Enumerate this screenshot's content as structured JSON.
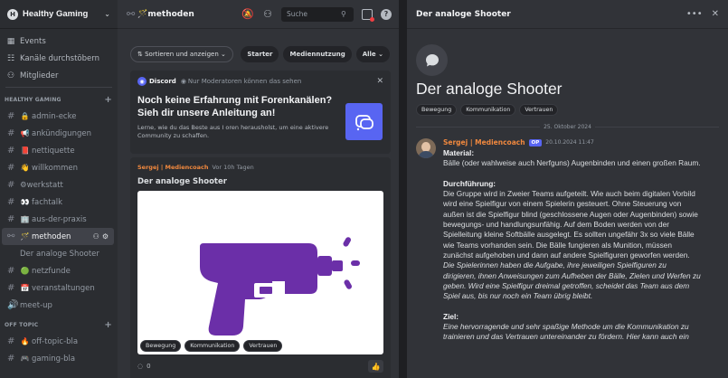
{
  "server": {
    "name": "Healthy Gaming",
    "icon_letter": "H"
  },
  "nav": [
    {
      "label": "Events",
      "icon": "calendar-icon"
    },
    {
      "label": "Kanäle durchstöbern",
      "icon": "browse-icon"
    },
    {
      "label": "Mitglieder",
      "icon": "members-icon"
    }
  ],
  "categories": {
    "healthy": "HEALTHY GAMING",
    "offtopic": "OFF TOPIC"
  },
  "channels": [
    {
      "prefix": "#",
      "emoji": "🔒",
      "name": "admin-ecke"
    },
    {
      "prefix": "#",
      "emoji": "📢",
      "name": "ankündigungen"
    },
    {
      "prefix": "#",
      "emoji": "📕",
      "name": "nettiquette"
    },
    {
      "prefix": "#",
      "emoji": "👋",
      "name": "willkommen"
    },
    {
      "prefix": "#",
      "emoji": "",
      "name": "⚙werkstatt"
    },
    {
      "prefix": "#",
      "emoji": "👀",
      "name": "fachtalk"
    },
    {
      "prefix": "#",
      "emoji": "🏢",
      "name": "aus-der-praxis"
    }
  ],
  "active_channel": {
    "name": "methoden",
    "emoji": "🪄"
  },
  "sub_thread": "Der analoge Shooter",
  "channels_after": [
    {
      "prefix": "#",
      "emoji": "🟢",
      "name": "netzfunde"
    },
    {
      "prefix": "#",
      "emoji": "📅",
      "name": "veranstaltungen"
    },
    {
      "prefix": "🔊",
      "emoji": "",
      "name": "meet-up"
    }
  ],
  "offtopic_channels": [
    {
      "prefix": "#",
      "emoji": "🔥",
      "name": "off-topic-bla"
    },
    {
      "prefix": "#",
      "emoji": "🎮",
      "name": "gaming-bla"
    }
  ],
  "forum": {
    "title": "🪄methoden",
    "search_placeholder": "Suche",
    "sort_label": "⇅ Sortieren und anzeigen ⌄",
    "filter_tags": [
      "Starter",
      "Mediennutzung",
      "Alle ⌄"
    ]
  },
  "notice": {
    "brand": "Discord",
    "visibility": "Nur Moderatoren können das sehen",
    "title": "Noch keine Erfahrung mit Forenkanälen? Sieh dir unsere Anleitung an!",
    "text": "Lerne, wie du das Beste aus I oren herausholst, um eine aktivere Community zu schaffen."
  },
  "post": {
    "author": "Sergej | Mediencoach",
    "time": "Vor 10h Tagen",
    "title": "Der analoge Shooter",
    "tags": [
      "Bewegung",
      "Kommunikation",
      "Vertrauen"
    ],
    "reactions": "0",
    "image_color": "#6b2fa8"
  },
  "thread": {
    "header_title": "Der analoge Shooter",
    "title": "Der analoge Shooter",
    "tags": [
      "Bewegung",
      "Kommunikation",
      "Vertrauen"
    ],
    "date_divider": "25. Oktober 2024",
    "author": "Sergej | Mediencoach",
    "badge": "OP",
    "timestamp": "20.10.2024 11:47",
    "material_label": "Material:",
    "material_text": "Bälle (oder wahlweise auch Nerfguns) Augenbinden und einen großen Raum.",
    "procedure_label": "Durchführung:",
    "procedure_text": "Die Gruppe wird in Zweier Teams aufgeteilt. Wie auch beim digitalen Vorbild wird eine Spielfigur von einem Spielerin gesteuert. Ohne Steuerung von außen ist die Spielfigur blind (geschlossene Augen oder Augenbinden) sowie bewegungs- und handlungsunfähig. Auf dem Boden werden von der Spielleitung kleine Softbälle ausgelegt. Es sollten ungefähr 3x so viele Bälle wie Teams vorhanden sein. Die Bälle fungieren als Munition, müssen zunächst aufgehoben und dann auf andere Spielfiguren geworfen werden.",
    "procedure_italic": "Die Spielerinnen haben die Aufgabe, ihre jeweiligen Spielfiguren zu dirigieren, ihnen Anweisungen zum Aufheben der Bälle, Zielen und Werfen zu geben. Wird eine Spielfigur dreimal getroffen, scheidet das Team aus dem Spiel aus, bis nur noch ein Team übrig bleibt.",
    "goal_label": "Ziel:",
    "goal_text": "Eine hervorragende und sehr spaßige Methode um die Kommunikation zu trainieren und das Vertrauen untereinander zu fördern. Hier kann auch ein"
  }
}
